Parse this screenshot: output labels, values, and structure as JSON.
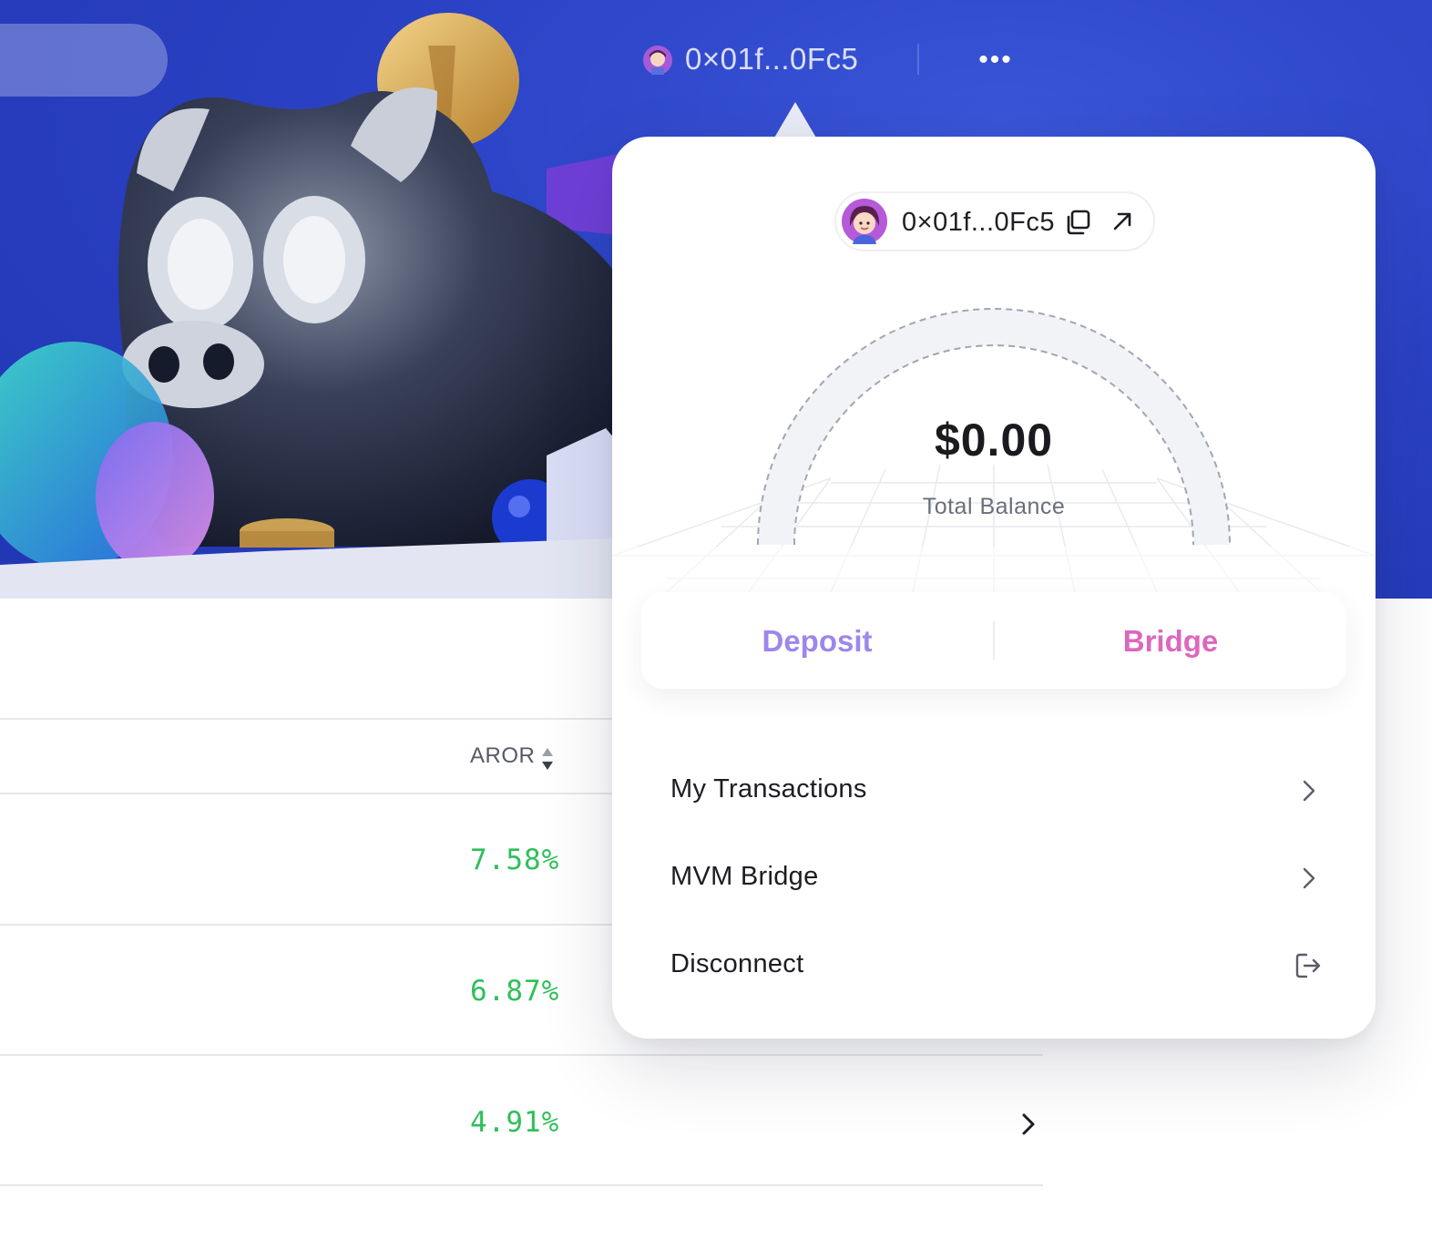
{
  "header": {
    "wallet_address": "0×01f...0Fc5",
    "more_label": "•••"
  },
  "table": {
    "column_header": "AROR",
    "rows": [
      {
        "rate": "7.58%"
      },
      {
        "rate": "6.87%"
      },
      {
        "rate": "4.91%"
      }
    ]
  },
  "wallet_panel": {
    "address": "0×01f...0Fc5",
    "balance": "$0.00",
    "balance_label": "Total Balance",
    "actions": {
      "deposit": "Deposit",
      "bridge": "Bridge"
    },
    "menu": [
      {
        "label": "My Transactions",
        "icon": "chevron-right-icon"
      },
      {
        "label": "MVM Bridge",
        "icon": "chevron-right-icon"
      },
      {
        "label": "Disconnect",
        "icon": "logout-icon"
      }
    ]
  },
  "colors": {
    "hero_blue": "#2a41c4",
    "rate_green": "#2fbf5a",
    "deposit_purple": "#9d87ec",
    "bridge_pink": "#dd67bd"
  }
}
